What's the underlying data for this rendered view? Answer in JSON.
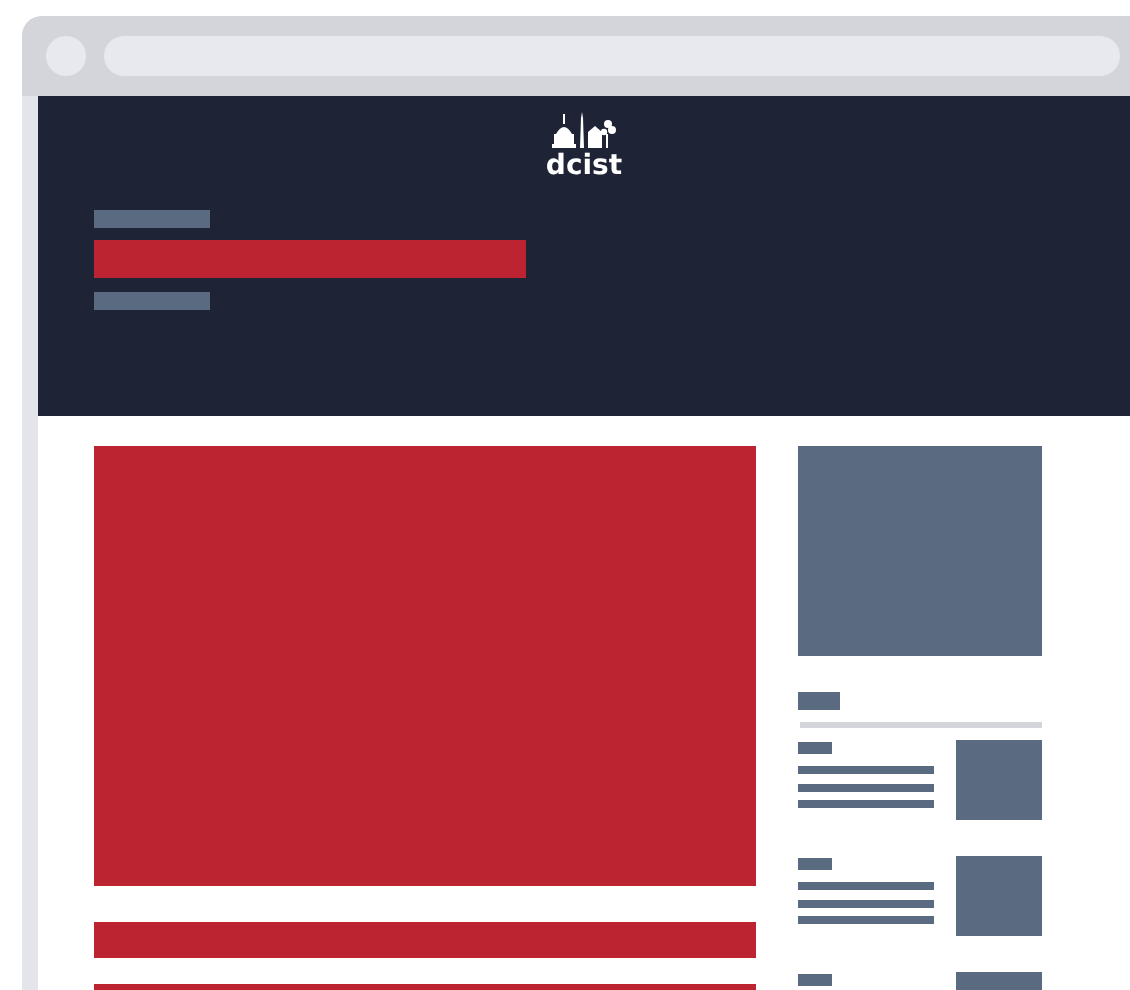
{
  "site_logo": {
    "text": "dcist"
  },
  "sidebar_teasers": [
    {
      "kind": "teaser"
    },
    {
      "kind": "teaser"
    },
    {
      "kind": "teaser"
    }
  ]
}
